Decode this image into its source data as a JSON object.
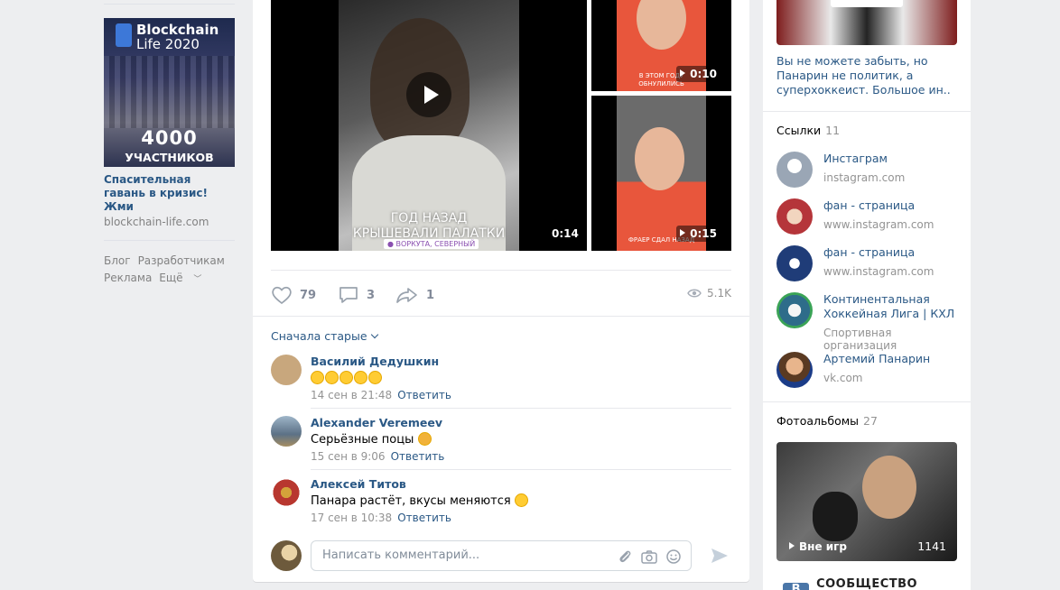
{
  "ad": {
    "brand_line1": "Blockchain",
    "brand_line2": "Life 2020",
    "big_text": "4000",
    "sub_text": "УЧАСТНИКОВ",
    "title": "Спасительная гавань в кризис! Жми",
    "domain": "blockchain-life.com"
  },
  "footer_links": [
    "Блог",
    "Разработчикам",
    "Реклама",
    "Ещё"
  ],
  "post": {
    "main_video": {
      "overlay_line1": "ГОД НАЗАД",
      "overlay_line2": "КРЫШЕВАЛИ ПАЛАТКИ",
      "location_tag": "ВОРКУТА, СЕВЕРНЫЙ",
      "duration": "0:14"
    },
    "video_2": {
      "caption": "В ЭТОМ ГОДУ ОБНУЛИЛИСЬ",
      "duration": "0:10"
    },
    "video_3": {
      "caption": "ФРАЕР СДАЛ НАЗАД",
      "duration": "0:15"
    },
    "likes": "79",
    "comments": "3",
    "shares": "1",
    "views": "5.1K"
  },
  "comments_sort": "Сначала старые",
  "comments": [
    {
      "author": "Василий Дедушкин",
      "text": "",
      "emoji_count": 5,
      "date": "14 сен в 21:48",
      "reply": "Ответить",
      "avatar_color": "#c8a77d"
    },
    {
      "author": "Alexander Veremeev",
      "text": "Серьёзные поцы",
      "emoji_count": 1,
      "date": "15 сен в 9:06",
      "reply": "Ответить",
      "avatar_color": "#6f8fa8"
    },
    {
      "author": "Алексей Титов",
      "text": "Панара растёт, вкусы меняются",
      "emoji_count": 1,
      "date": "17 сен в 10:38",
      "reply": "Ответить",
      "avatar_color": "#b8372f"
    }
  ],
  "composer": {
    "placeholder": "Написать комментарий..."
  },
  "right": {
    "news_text": "Вы не можете забыть, но Панарин не политик, а суперхоккеист. Большое ин..",
    "links_title": "Ссылки",
    "links_count": "11",
    "links": [
      {
        "title": "Инстаграм",
        "sub": "instagram.com",
        "color": "#9aa6b5"
      },
      {
        "title": "фан - страница",
        "sub": "www.instagram.com",
        "color": "#b5353a"
      },
      {
        "title": "фан - страница",
        "sub": "www.instagram.com",
        "color": "#1f3c78"
      },
      {
        "title": "Континентальная Хоккейная Лига | КХЛ",
        "sub": "Спортивная организация",
        "color": "#2e6c8a"
      },
      {
        "title": "Артемий Панарин",
        "sub": "vk.com",
        "color": "#c88d63"
      }
    ],
    "albums_title": "Фотоальбомы",
    "albums_count": "27",
    "album_caption": "Вне игр",
    "album_count": "1141",
    "community_title": "СООБЩЕСТВО \"ВКОНТАК"
  }
}
